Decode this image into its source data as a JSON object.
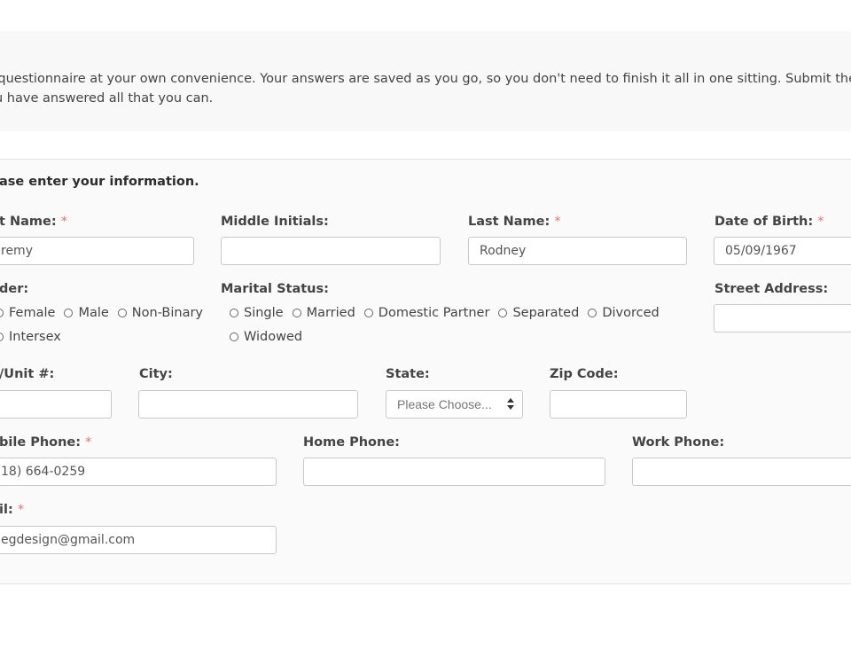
{
  "intro": {
    "line1": "his questionnaire at your own convenience. Your answers are saved as you go, so you don't need to finish it all in one sitting. Submit the fo",
    "line2": "u have answered all that you can."
  },
  "form": {
    "heading": "ase enter your information.",
    "required_mark": "*",
    "first_name": {
      "label": "t Name:",
      "value": "remy"
    },
    "middle_initials": {
      "label": "Middle Initials:",
      "value": ""
    },
    "last_name": {
      "label": "Last Name:",
      "value": "Rodney"
    },
    "dob": {
      "label": "Date of Birth:",
      "value": "05/09/1967"
    },
    "gender": {
      "label": "der:",
      "options": [
        "Female",
        "Male",
        "Non-Binary",
        "Intersex"
      ]
    },
    "marital": {
      "label": "Marital Status:",
      "options": [
        "Single",
        "Married",
        "Domestic Partner",
        "Separated",
        "Divorced",
        "Widowed"
      ]
    },
    "street": {
      "label": "Street Address:",
      "value": ""
    },
    "unit": {
      "label": "/Unit #:",
      "value": ""
    },
    "city": {
      "label": "City:",
      "value": ""
    },
    "state": {
      "label": "State:",
      "selected": "Please Choose..."
    },
    "zip": {
      "label": "Zip Code:",
      "value": ""
    },
    "mobile": {
      "label": "bile Phone:",
      "value": "18) 664-0259"
    },
    "home_phone": {
      "label": "Home Phone:",
      "value": ""
    },
    "work_phone": {
      "label": "Work Phone:",
      "value": ""
    },
    "email": {
      "label": "il:",
      "value": "egdesign@gmail.com"
    }
  },
  "colors": {
    "required": "#e57373",
    "panel_bg": "#fafafa",
    "intro_bg": "#f8f8f8"
  }
}
